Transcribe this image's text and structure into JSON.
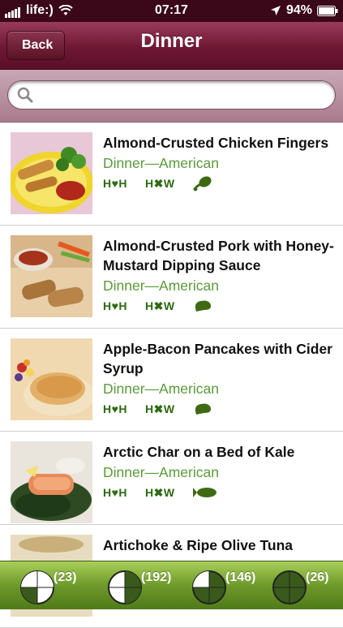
{
  "status_bar": {
    "carrier": "life:)",
    "time": "07:17",
    "battery": "94%"
  },
  "nav": {
    "back_label": "Back",
    "title": "Dinner"
  },
  "search": {
    "value": "",
    "placeholder": ""
  },
  "recipes": [
    {
      "name": "Almond-Crusted Chicken Fingers",
      "category": "Dinner—American",
      "tag1": "H♥H",
      "tag2": "H✖W",
      "protein_icon": "drumstick-icon"
    },
    {
      "name": "Almond-Crusted Pork with Honey-Mustard Dipping Sauce",
      "category": "Dinner—American",
      "tag1": "H♥H",
      "tag2": "H✖W",
      "protein_icon": "pork-icon"
    },
    {
      "name": "Apple-Bacon Pancakes with Cider Syrup",
      "category": "Dinner—American",
      "tag1": "H♥H",
      "tag2": "H✖W",
      "protein_icon": "pork-icon"
    },
    {
      "name": "Arctic Char on a Bed of Kale",
      "category": "Dinner—American",
      "tag1": "H♥H",
      "tag2": "H✖W",
      "protein_icon": "fish-icon"
    },
    {
      "name": "Artichoke & Ripe Olive Tuna",
      "category": "",
      "tag1": "",
      "tag2": "",
      "protein_icon": ""
    }
  ],
  "tabs": [
    {
      "count": "(23)",
      "icon": "clock-quarter-icon",
      "fill_fraction": 0.25
    },
    {
      "count": "(192)",
      "icon": "clock-half-icon",
      "fill_fraction": 0.5
    },
    {
      "count": "(146)",
      "icon": "clock-three-quarter-icon",
      "fill_fraction": 0.75
    },
    {
      "count": "(26)",
      "icon": "clock-full-icon",
      "fill_fraction": 1.0
    }
  ],
  "colors": {
    "nav_bar": "#6e1834",
    "category_text": "#5a9a3a",
    "tag_text": "#2e6a12",
    "tab_bar": "#6d9a2a"
  }
}
